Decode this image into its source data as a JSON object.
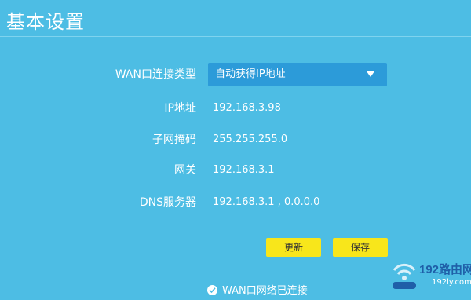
{
  "page": {
    "title": "基本设置"
  },
  "form": {
    "wan_type": {
      "label": "WAN口连接类型",
      "selected": "自动获得IP地址"
    },
    "ip": {
      "label": "IP地址",
      "value": "192.168.3.98"
    },
    "subnet": {
      "label": "子网掩码",
      "value": "255.255.255.0"
    },
    "gateway": {
      "label": "网关",
      "value": "192.168.3.1"
    },
    "dns": {
      "label": "DNS服务器",
      "value": "192.168.3.1 , 0.0.0.0"
    }
  },
  "buttons": {
    "refresh_label": "更新",
    "save_label": "保存"
  },
  "status": {
    "text": "WAN口网络已连接"
  },
  "watermark": {
    "text": "192路由网",
    "url": "192ly.com"
  },
  "colors": {
    "background": "#4dbde4",
    "select_bg": "#2c9bd9",
    "button_bg": "#f8e61b"
  },
  "icons": {
    "dropdown": "chevron-down-icon",
    "status": "check-circle-icon",
    "watermark_logo": "wifi-signal-icon"
  }
}
